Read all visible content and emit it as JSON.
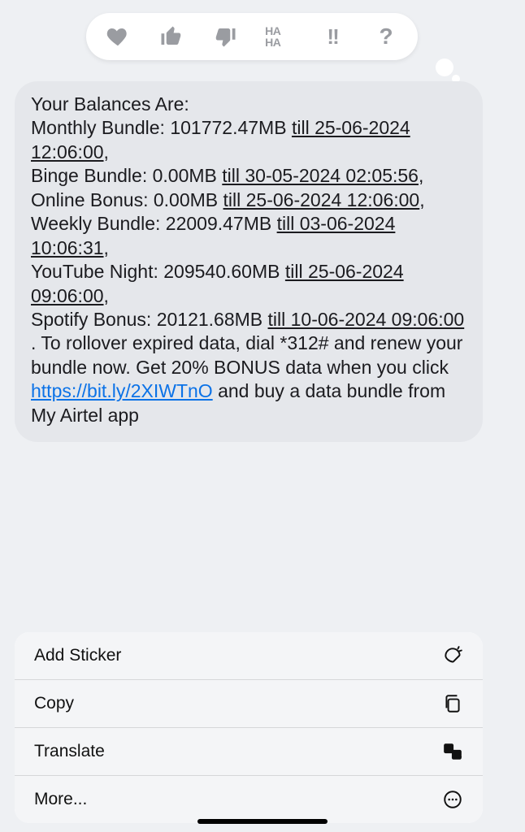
{
  "tapback": {
    "heart": "heart-icon",
    "thumbs_up": "thumbs-up-icon",
    "thumbs_down": "thumbs-down-icon",
    "haha": "HA HA",
    "emphasis": "!!",
    "question": "?"
  },
  "message": {
    "header": "Your Balances Are:",
    "items": [
      {
        "label": "Monthly Bundle: ",
        "value": "101772.47MB ",
        "till": "till 25-06-2024 12:06:00",
        "suffix": ","
      },
      {
        "label": "Binge Bundle: ",
        "value": "0.00MB ",
        "till": "till 30-05-2024 02:05:56",
        "suffix": ","
      },
      {
        "label": "Online Bonus: ",
        "value": "0.00MB ",
        "till": "till 25-06-2024 12:06:00",
        "suffix": ","
      },
      {
        "label": "Weekly Bundle: ",
        "value": "22009.47MB ",
        "till": "till 03-06-2024 10:06:31",
        "suffix": ","
      },
      {
        "label": "YouTube Night: ",
        "value": "209540.60MB ",
        "till": "till 25-06-2024 09:06:00",
        "suffix": ","
      },
      {
        "label": "Spotify Bonus: ",
        "value": "20121.68MB ",
        "till": "till 10-06-2024 09:06:00",
        "suffix": ""
      }
    ],
    "footer_before_link": ". To rollover expired data, dial *312# and renew your bundle now. Get 20% BONUS data when you click ",
    "link_text": "https://bit.ly/2XIWTnO",
    "footer_after_link": " and buy a data bundle from My Airtel app"
  },
  "menu": {
    "add_sticker": "Add Sticker",
    "copy": "Copy",
    "translate": "Translate",
    "more": "More..."
  }
}
